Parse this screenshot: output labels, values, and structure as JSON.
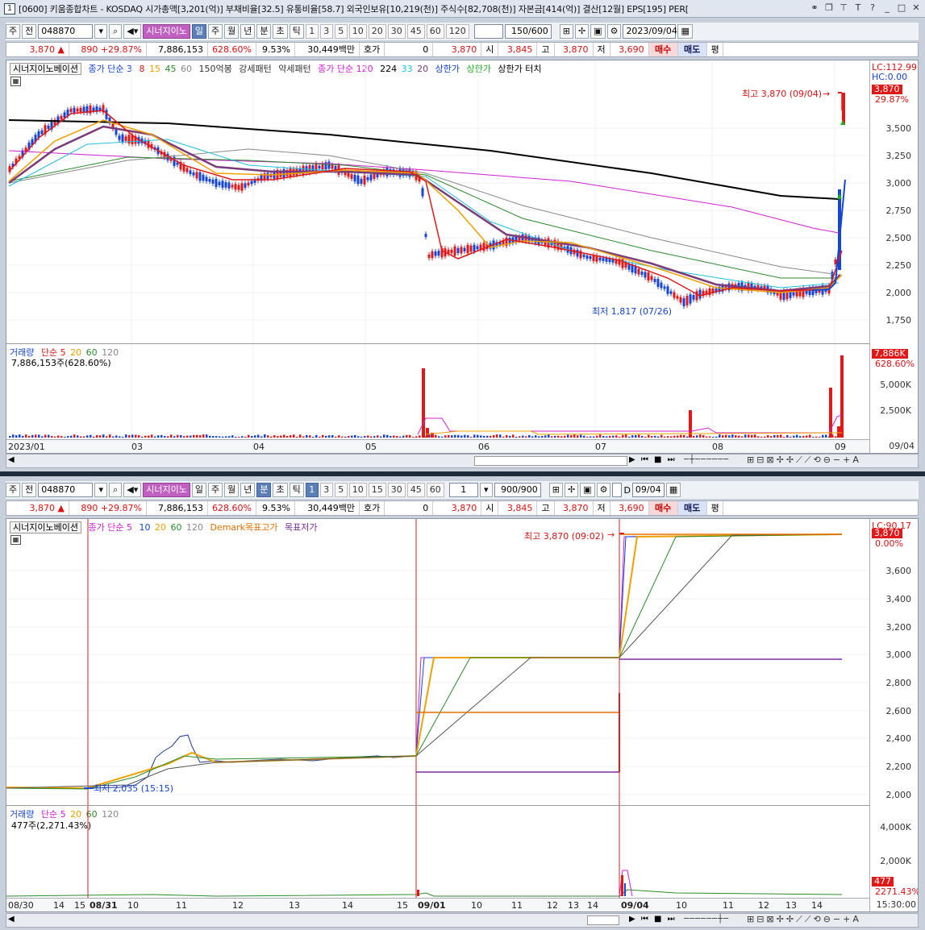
{
  "window": {
    "screen_no": "1",
    "title": "[0600] 키움종합차트 - KOSDAQ 시가총액[3,201(억)] 부채비율[32.5] 유통비율[58.7] 외국인보유[10,219(천)] 주식수[82,708(천)] 자본금[414(억)] 결산[12월] EPS[195] PER["
  },
  "panel_top": {
    "toolbar": {
      "mode": "주",
      "prev": "전",
      "code": "048870",
      "indicator_btn": "시너지이노",
      "periods": [
        "일",
        "주",
        "월",
        "년",
        "분",
        "초",
        "틱"
      ],
      "active_period": "일",
      "nums": [
        "1",
        "3",
        "5",
        "10",
        "20",
        "30",
        "45",
        "60",
        "120"
      ],
      "count": "150/600",
      "date": "2023/09/04"
    },
    "price": {
      "price": "3,870",
      "change": "890",
      "rate": "+29.87%",
      "volume": "7,886,153",
      "vol_ratio": "628.60%",
      "turnover": "9.53%",
      "amount": "30,449백만",
      "quote_label": "호가",
      "quote_val": "0",
      "last": "3,870",
      "open_label": "시",
      "open": "3,845",
      "high_label": "고",
      "high": "3,870",
      "low_label": "저",
      "low": "3,690",
      "buy": "매수",
      "sell": "매도",
      "eval": "평"
    },
    "legend": [
      "시너지이노베이션",
      "종가 단순 3",
      "8",
      "15",
      "45",
      "60",
      "150억봉",
      "강세패턴",
      "약세패턴",
      "종가 단순 120",
      "224",
      "33",
      "20",
      "상한가",
      "상한가",
      "상한가 터치"
    ],
    "lc": "LC:112.99",
    "hc": "HC:0.00",
    "price_axis": [
      "3,500",
      "3,250",
      "3,000",
      "2,750",
      "2,500",
      "2,250",
      "2,000",
      "1,750"
    ],
    "last_tag": "3,870",
    "last_tag_pct": "29.87%",
    "high_note": "최고 3,870 (09/04)",
    "low_note": "최저 1,817 (07/26)",
    "vol_legend": [
      "거래량",
      "단순 5",
      "20",
      "60",
      "120"
    ],
    "vol_value": "7,886,153주(628.60%)",
    "vol_axis": [
      "5,000K",
      "2,500K"
    ],
    "vol_tag": "7,886K",
    "vol_tag_pct": "628.60%",
    "x_labels": [
      "2023/01",
      "03",
      "04",
      "05",
      "06",
      "07",
      "08",
      "09"
    ],
    "x_end": "09/04"
  },
  "panel_bottom": {
    "toolbar": {
      "mode": "주",
      "prev": "전",
      "code": "048870",
      "indicator_btn": "시너지이노",
      "periods": [
        "일",
        "주",
        "월",
        "년",
        "분",
        "초",
        "틱"
      ],
      "active_period": "분",
      "nums": [
        "1",
        "3",
        "5",
        "10",
        "15",
        "30",
        "45",
        "60"
      ],
      "unit": "1",
      "count": "900/900",
      "date": "09/04",
      "d_label": "D"
    },
    "price": {
      "price": "3,870",
      "change": "890",
      "rate": "+29.87%",
      "volume": "7,886,153",
      "vol_ratio": "628.60%",
      "turnover": "9.53%",
      "amount": "30,449백만",
      "quote_label": "호가",
      "quote_val": "0",
      "last": "3,870",
      "open_label": "시",
      "open": "3,845",
      "high_label": "고",
      "high": "3,870",
      "low_label": "저",
      "low": "3,690",
      "buy": "매수",
      "sell": "매도",
      "eval": "평"
    },
    "legend": [
      "시너지이노베이션",
      "종가 단순 5",
      "10",
      "20",
      "60",
      "120",
      "Demark목표고가",
      "목표저가"
    ],
    "lc": "LC:90.17",
    "price_axis": [
      "3,600",
      "3,400",
      "3,200",
      "3,000",
      "2,800",
      "2,600",
      "2,400",
      "2,200",
      "2,000"
    ],
    "last_tag": "3,870",
    "last_tag_pct": "0.00%",
    "high_note": "최고 3,870 (09:02)",
    "low_note": "최저 2,035 (15:15)",
    "vol_legend": [
      "거래량",
      "단순 5",
      "20",
      "60",
      "120"
    ],
    "vol_value": "477주(2,271.43%)",
    "vol_axis": [
      "4,000K",
      "2,000K"
    ],
    "vol_tag": "477",
    "vol_tag_pct": "2271.43%",
    "x_labels": [
      "08/30",
      "14",
      "15",
      "08/31",
      "10",
      "11",
      "12",
      "13",
      "14",
      "15",
      "09/01",
      "10",
      "11",
      "12",
      "13",
      "14",
      "09/04",
      "10",
      "11",
      "12",
      "13",
      "14"
    ],
    "x_end": "15:30:00"
  },
  "colors": {
    "up": "#e01818",
    "down": "#1444d8",
    "ma3": "#e01818",
    "ma8": "#f0a000",
    "ma15": "#7a3b7a",
    "ma45": "#20c0e0",
    "ma60": "#2a8a2a",
    "ma120": "#d020d0",
    "ma224": "#000000"
  }
}
